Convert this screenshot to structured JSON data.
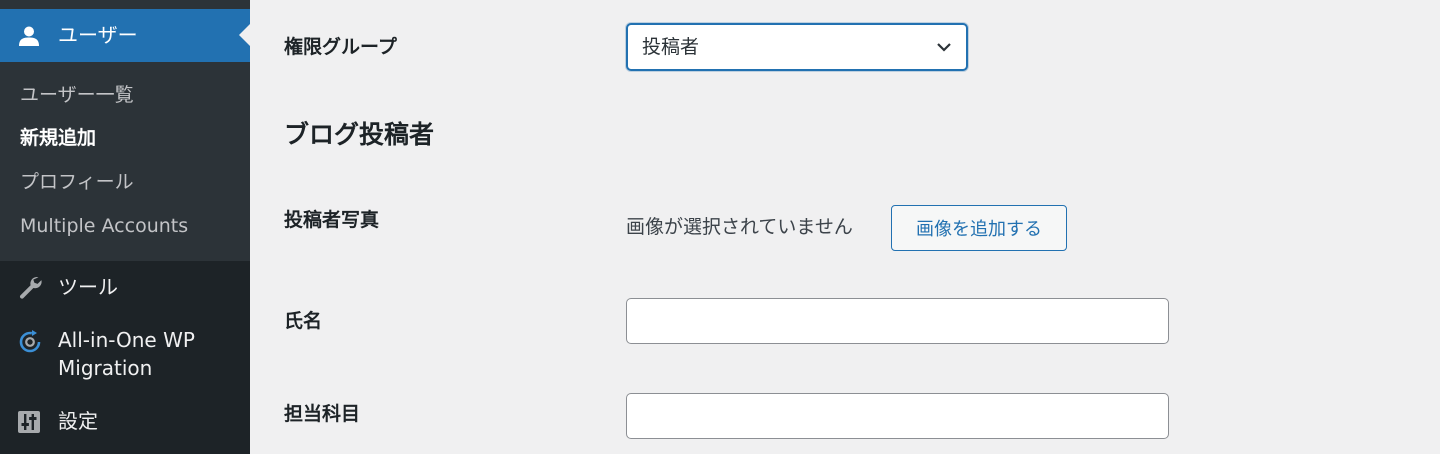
{
  "sidebar": {
    "users_menu": {
      "label": "ユーザー",
      "icon": "user-icon"
    },
    "users_submenu": [
      {
        "label": "ユーザー一覧"
      },
      {
        "label": "新規追加",
        "current": true
      },
      {
        "label": "プロフィール"
      },
      {
        "label": "Multiple Accounts"
      }
    ],
    "tools": {
      "label": "ツール",
      "icon": "wrench-icon"
    },
    "migration": {
      "label_line1": "All-in-One WP",
      "label_line2": "Migration",
      "icon": "migration-icon"
    },
    "settings": {
      "label": "設定",
      "icon": "settings-sliders-icon"
    }
  },
  "form": {
    "role_group": {
      "label": "権限グループ",
      "selected": "投稿者"
    },
    "section_title": "ブログ投稿者",
    "author_photo": {
      "label": "投稿者写真",
      "status": "画像が選択されていません",
      "button": "画像を追加する"
    },
    "full_name": {
      "label": "氏名",
      "value": ""
    },
    "subject": {
      "label": "担当科目",
      "value": ""
    }
  },
  "colors": {
    "sidebar_bg": "#1d2327",
    "submenu_bg": "#2c3338",
    "accent": "#2271b1",
    "page_bg": "#f0f0f1"
  }
}
